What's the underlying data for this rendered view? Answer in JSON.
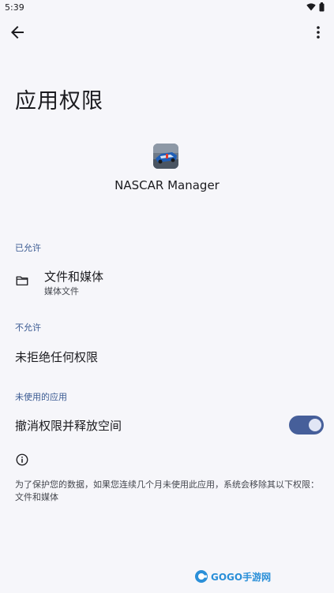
{
  "status_bar": {
    "time": "5:39",
    "icons": [
      "wifi-icon",
      "battery-icon"
    ]
  },
  "app_bar": {
    "back_icon": "arrow-left-icon",
    "menu_icon": "more-vertical-icon"
  },
  "page": {
    "title": "应用权限",
    "app_name": "NASCAR Manager"
  },
  "sections": {
    "allowed": {
      "header": "已允许",
      "item": {
        "icon": "folder-icon",
        "title": "文件和媒体",
        "subtitle": "媒体文件"
      }
    },
    "not_allowed": {
      "header": "不允许",
      "text": "未拒绝任何权限"
    },
    "unused_apps": {
      "header": "未使用的应用",
      "toggle_label": "撤消权限并释放空间",
      "toggle_on": true,
      "info_icon": "info-icon",
      "footer_text": "为了保护您的数据，如果您连续几个月未使用此应用，系统会移除其以下权限：文件和媒体"
    }
  },
  "watermark": {
    "text": "GOGO手游网"
  },
  "colors": {
    "background": "#f6f6fa",
    "accent": "#465f9a",
    "section_header": "#3a5a92"
  }
}
